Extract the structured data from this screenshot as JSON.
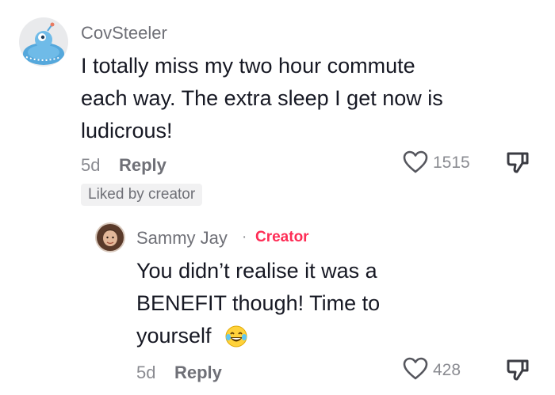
{
  "comment": {
    "username": "CovSteeler",
    "text_lines": [
      "I totally miss my two hour commute",
      "each way. The extra sleep I get now is",
      "ludicrous!"
    ],
    "time": "5d",
    "reply_label": "Reply",
    "like_count": "1515",
    "liked_by_creator": "Liked by creator"
  },
  "reply": {
    "username": "Sammy Jay",
    "separator": "·",
    "creator_label": "Creator",
    "text_lines": [
      "You didn’t realise it was a",
      "BENEFIT though! Time to",
      "yourself"
    ],
    "time": "5d",
    "reply_label": "Reply",
    "like_count": "428"
  },
  "icons": {
    "heart": "heart-outline-icon",
    "dislike": "thumbs-down-icon",
    "emoji": "face-with-tears-of-joy-icon"
  },
  "colors": {
    "creator_accent": "#fe2c55",
    "avatar_bg": "#e6e7ea",
    "avatar_alien": "#4fa3d8"
  }
}
